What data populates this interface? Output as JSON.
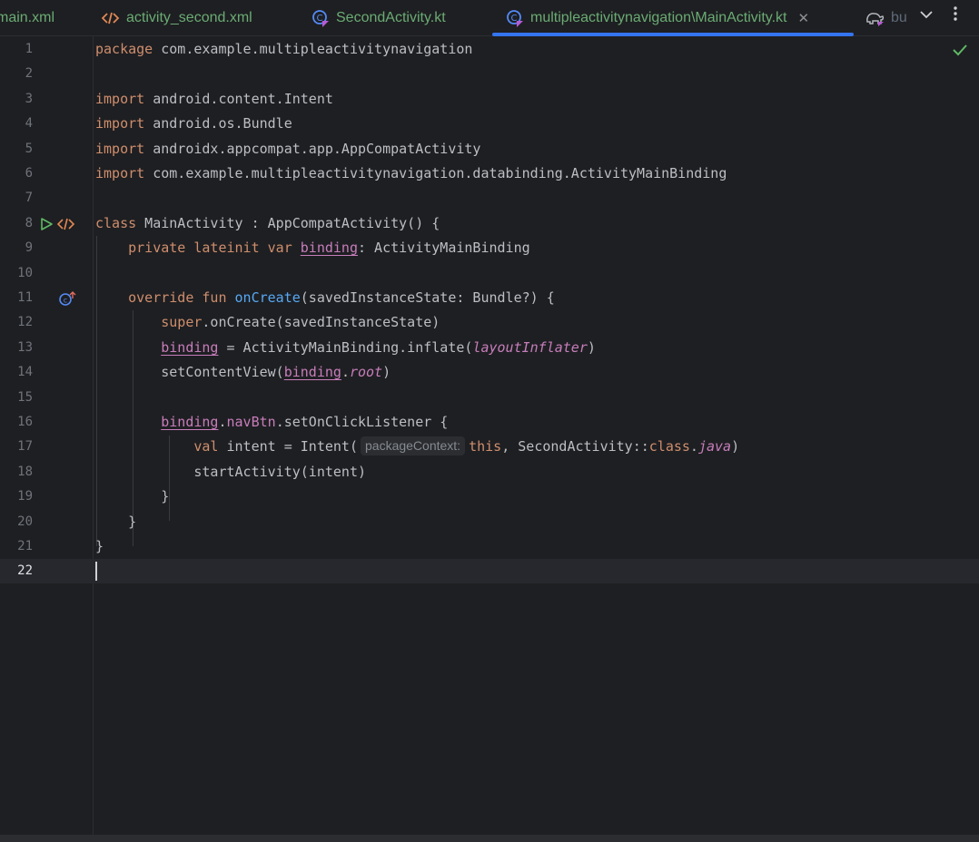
{
  "tabs": [
    {
      "label": "main.xml",
      "icon": "none",
      "active": false
    },
    {
      "label": "activity_second.xml",
      "icon": "xml-tag-icon",
      "active": false
    },
    {
      "label": "SecondActivity.kt",
      "icon": "kotlin-class-icon",
      "active": false
    },
    {
      "label": "multipleactivitynavigation\\MainActivity.kt",
      "icon": "kotlin-class-icon",
      "active": true
    },
    {
      "label": "bu",
      "icon": "gradle-elephant-icon",
      "active": false
    }
  ],
  "tab_close_glyph": "✕",
  "editor": {
    "current_line": 22,
    "line_numbers": [
      "1",
      "2",
      "3",
      "4",
      "5",
      "6",
      "7",
      "8",
      "9",
      "10",
      "11",
      "12",
      "13",
      "14",
      "15",
      "16",
      "17",
      "18",
      "19",
      "20",
      "21",
      "22"
    ],
    "lines": [
      [
        {
          "t": "package",
          "c": "kw"
        },
        {
          "t": " com.example.multipleactivitynavigation"
        }
      ],
      [],
      [
        {
          "t": "import",
          "c": "kw"
        },
        {
          "t": " android.content.Intent"
        }
      ],
      [
        {
          "t": "import",
          "c": "kw"
        },
        {
          "t": " android.os.Bundle"
        }
      ],
      [
        {
          "t": "import",
          "c": "kw"
        },
        {
          "t": " androidx.appcompat.app.AppCompatActivity"
        }
      ],
      [
        {
          "t": "import",
          "c": "kw"
        },
        {
          "t": " com.example.multipleactivitynavigation.databinding.ActivityMainBinding"
        }
      ],
      [],
      [
        {
          "t": "class",
          "c": "kw"
        },
        {
          "t": " MainActivity : AppCompatActivity() {"
        }
      ],
      [
        {
          "t": "    "
        },
        {
          "t": "private lateinit var",
          "c": "kw"
        },
        {
          "t": " "
        },
        {
          "t": "binding",
          "c": "uprop"
        },
        {
          "t": ": ActivityMainBinding"
        }
      ],
      [],
      [
        {
          "t": "    "
        },
        {
          "t": "override fun",
          "c": "kw"
        },
        {
          "t": " "
        },
        {
          "t": "onCreate",
          "c": "fn"
        },
        {
          "t": "(savedInstanceState: Bundle?) {"
        }
      ],
      [
        {
          "t": "        "
        },
        {
          "t": "super",
          "c": "kw"
        },
        {
          "t": ".onCreate(savedInstanceState)"
        }
      ],
      [
        {
          "t": "        "
        },
        {
          "t": "binding",
          "c": "uprop"
        },
        {
          "t": " = ActivityMainBinding.inflate("
        },
        {
          "t": "layoutInflater",
          "c": "ital"
        },
        {
          "t": ")"
        }
      ],
      [
        {
          "t": "        setContentView("
        },
        {
          "t": "binding",
          "c": "uprop"
        },
        {
          "t": "."
        },
        {
          "t": "root",
          "c": "ital"
        },
        {
          "t": ")"
        }
      ],
      [],
      [
        {
          "t": "        "
        },
        {
          "t": "binding",
          "c": "uprop"
        },
        {
          "t": "."
        },
        {
          "t": "navBtn",
          "c": "prop"
        },
        {
          "t": ".setOnClickListener {"
        }
      ],
      [
        {
          "t": "            "
        },
        {
          "t": "val",
          "c": "kw"
        },
        {
          "t": " intent = Intent("
        },
        {
          "t": "packageContext:",
          "c": "hint"
        },
        {
          "t": "this",
          "c": "kw"
        },
        {
          "t": ", SecondActivity::"
        },
        {
          "t": "class",
          "c": "kw"
        },
        {
          "t": "."
        },
        {
          "t": "java",
          "c": "ital"
        },
        {
          "t": ")"
        }
      ],
      [
        {
          "t": "            startActivity(intent)"
        }
      ],
      [
        {
          "t": "        }"
        }
      ],
      [
        {
          "t": "    }"
        }
      ],
      [
        {
          "t": "}"
        }
      ],
      []
    ],
    "gutter_icons": [
      {
        "line": 8,
        "icon": "run-icon"
      },
      {
        "line": 8,
        "icon": "layout-xml-icon"
      },
      {
        "line": 11,
        "icon": "override-method-icon"
      }
    ],
    "inspection_status_icon": "checkmark-icon"
  },
  "colors": {
    "background": "#1e1f22",
    "keyword": "#cf8e6d",
    "function": "#56a8f5",
    "property": "#c77dbb",
    "text": "#bcbec4",
    "tab_underline": "#3574f0",
    "tab_label": "#6aab73"
  }
}
